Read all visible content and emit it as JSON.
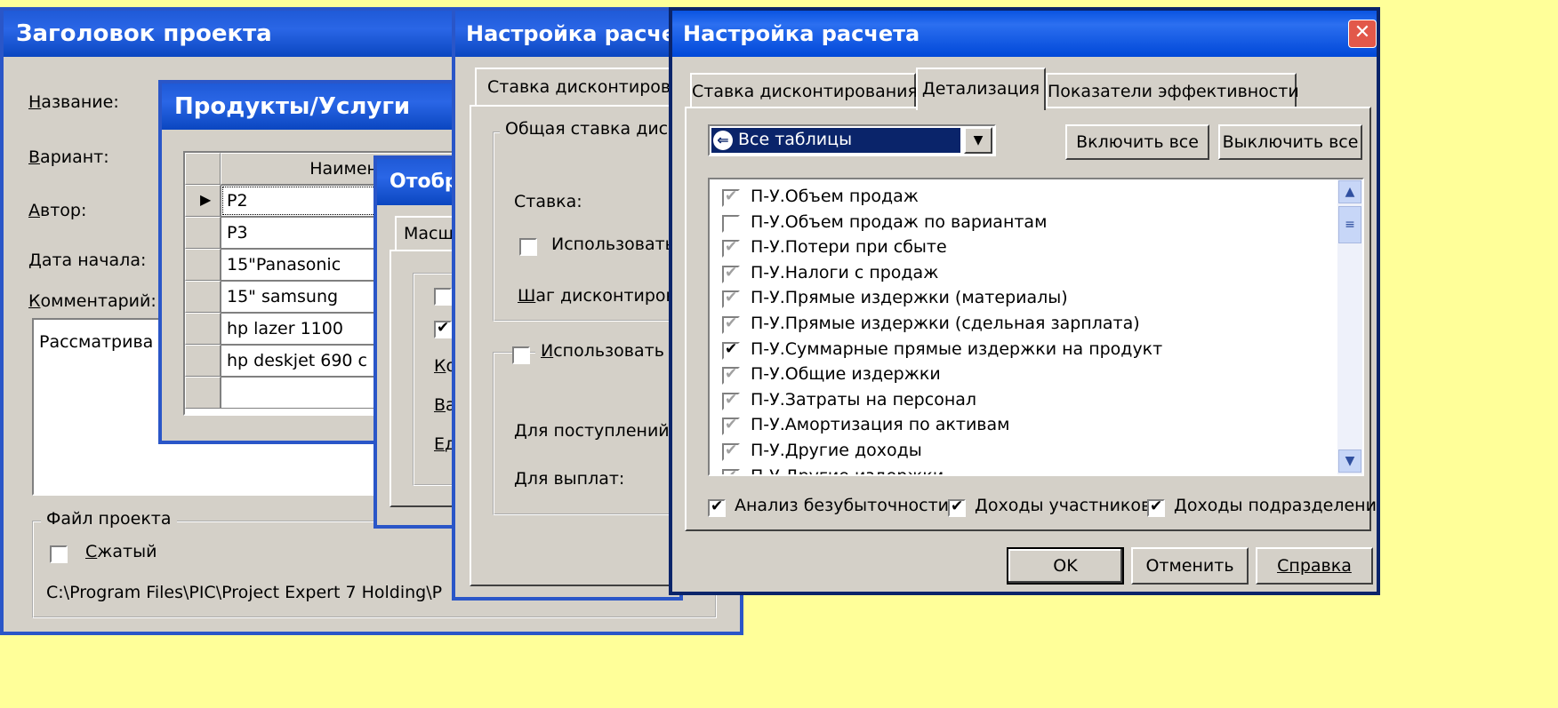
{
  "win1": {
    "title": "Заголовок проекта",
    "name_label": "Название:",
    "variant_label": "Вариант:",
    "author_label": "Автор:",
    "start_label": "Дата начала:",
    "comment_label": "Комментарий:",
    "comment_value": "Рассматрива",
    "file_group": "Файл проекта",
    "compressed_label": "Сжатый",
    "path": "C:\\Program Files\\PIC\\Project Expert 7 Holding\\P"
  },
  "win2": {
    "title": "Продукты/Услуги",
    "column_header": "Наименов",
    "rows": [
      "P2",
      "P3",
      "15\"Panasonic",
      "15\" samsung",
      "hp lazer 1100",
      "hp deskjet 690 c"
    ]
  },
  "win3": {
    "title": "Отобр",
    "tab": "Масшт",
    "labels": [
      "Ко",
      "Ва",
      "Ед"
    ]
  },
  "win4": {
    "title": "Настройка расчета",
    "tab": "Ставка дисконтирован",
    "group": "Общая ставка диско",
    "rate_label": "Ставка:",
    "use_label": "Использовать р",
    "step_label": "Шаг дисконтирова",
    "use2_label": "Использовать с",
    "income_label": "Для поступлений:",
    "payment_label": "Для выплат:"
  },
  "win5": {
    "title": "Настройка расчета",
    "tabs": [
      "Ставка дисконтирования",
      "Детализация",
      "Показатели эффективности"
    ],
    "dropdown_value": "Все таблицы",
    "enable_all": "Включить все",
    "disable_all": "Выключить все",
    "items": [
      {
        "label": "П-У.Объем продаж",
        "checked": true,
        "disabled": true
      },
      {
        "label": "П-У.Объем продаж по вариантам",
        "checked": false,
        "disabled": false
      },
      {
        "label": "П-У.Потери при сбыте",
        "checked": true,
        "disabled": true
      },
      {
        "label": "П-У.Налоги с продаж",
        "checked": true,
        "disabled": true
      },
      {
        "label": "П-У.Прямые издержки (материалы)",
        "checked": true,
        "disabled": true
      },
      {
        "label": "П-У.Прямые издержки (сдельная зарплата)",
        "checked": true,
        "disabled": true
      },
      {
        "label": "П-У.Суммарные прямые издержки на продукт",
        "checked": true,
        "disabled": false
      },
      {
        "label": "П-У.Общие издержки",
        "checked": true,
        "disabled": true
      },
      {
        "label": "П-У.Затраты на персонал",
        "checked": true,
        "disabled": true
      },
      {
        "label": "П-У.Амортизация по активам",
        "checked": true,
        "disabled": true
      },
      {
        "label": "П-У.Другие доходы",
        "checked": true,
        "disabled": true
      },
      {
        "label": "П-У.Другие издержки",
        "checked": true,
        "disabled": true
      }
    ],
    "breakeven": "Анализ безубыточности",
    "participants": "Доходы участников",
    "divisions": "Доходы подразделений",
    "ok": "OK",
    "cancel": "Отменить",
    "help": "Справка"
  }
}
